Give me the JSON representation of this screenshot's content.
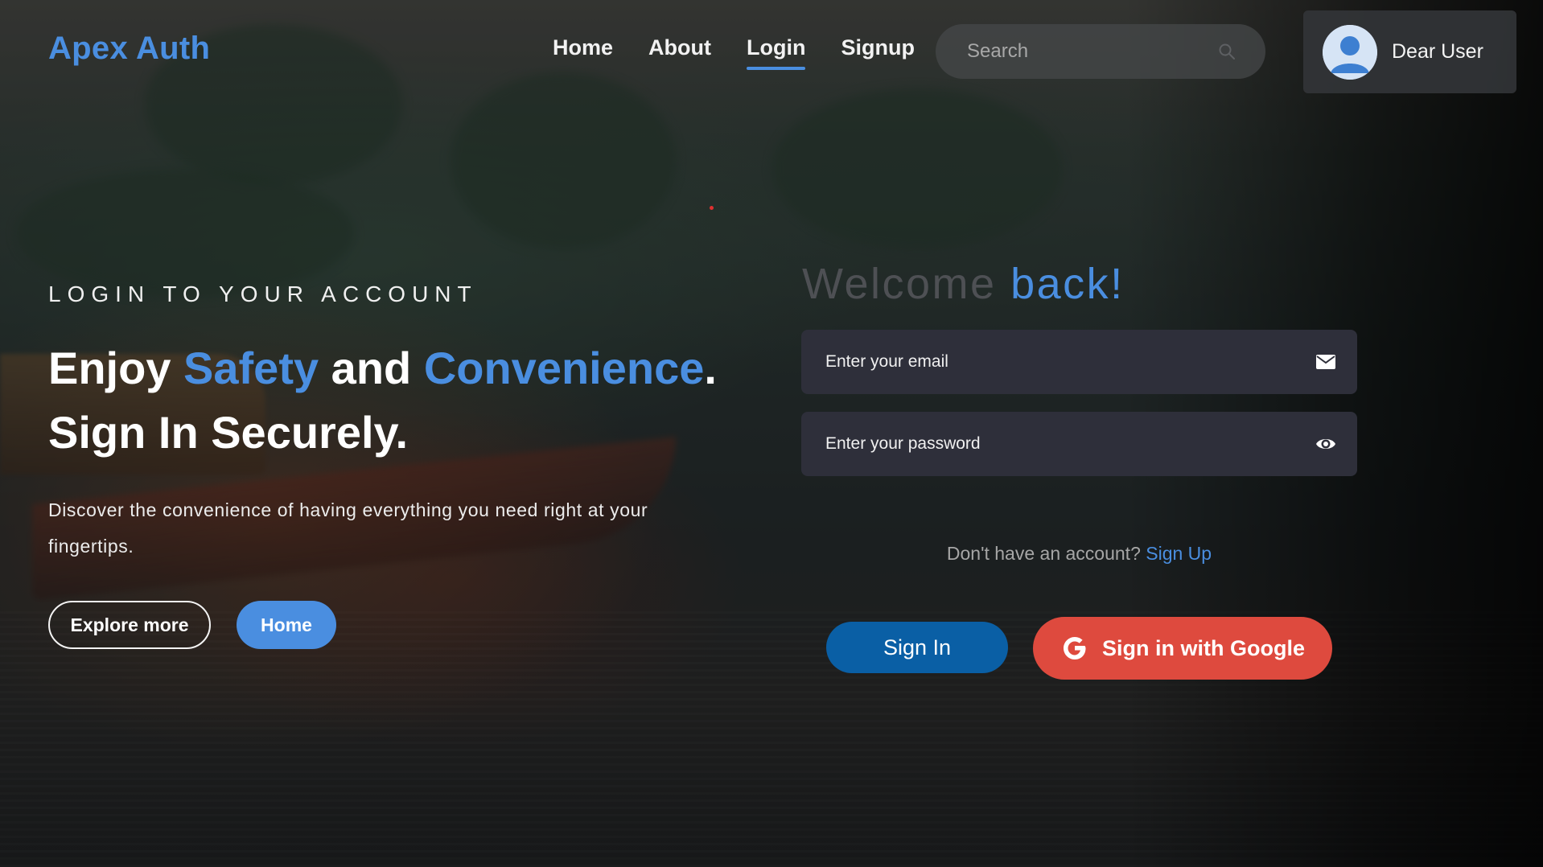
{
  "header": {
    "logo": "Apex Auth",
    "nav": [
      {
        "label": "Home",
        "active": false
      },
      {
        "label": "About",
        "active": false
      },
      {
        "label": "Login",
        "active": true
      },
      {
        "label": "Signup",
        "active": false
      }
    ],
    "search_placeholder": "Search",
    "user_name": "Dear User"
  },
  "hero": {
    "eyebrow": "LOGIN TO YOUR ACCOUNT",
    "headline_parts": {
      "p1": "Enjoy ",
      "accent1": "Safety",
      "p2": " and ",
      "accent2": "Convenience",
      "p3": ".",
      "line2": "Sign In Securely."
    },
    "description": "Discover the convenience of having everything you need right at your fingertips.",
    "explore_label": "Explore more",
    "home_label": "Home"
  },
  "form": {
    "welcome_part1": "Welcome ",
    "welcome_accent": "back!",
    "email_placeholder": "Enter your email",
    "password_placeholder": "Enter your password",
    "signup_prompt": "Don't have an account?",
    "signup_link": "Sign Up",
    "signin_label": "Sign In",
    "google_label": "Sign in with Google"
  },
  "colors": {
    "accent": "#4a8ee0",
    "signin_button": "#0a5fa5",
    "google_button": "#de4a3e",
    "field_bg": "#2e2f3a"
  },
  "icons": {
    "search": "search-icon",
    "avatar": "user-avatar-icon",
    "email": "envelope-icon",
    "password": "eye-icon",
    "google": "google-g-icon"
  }
}
